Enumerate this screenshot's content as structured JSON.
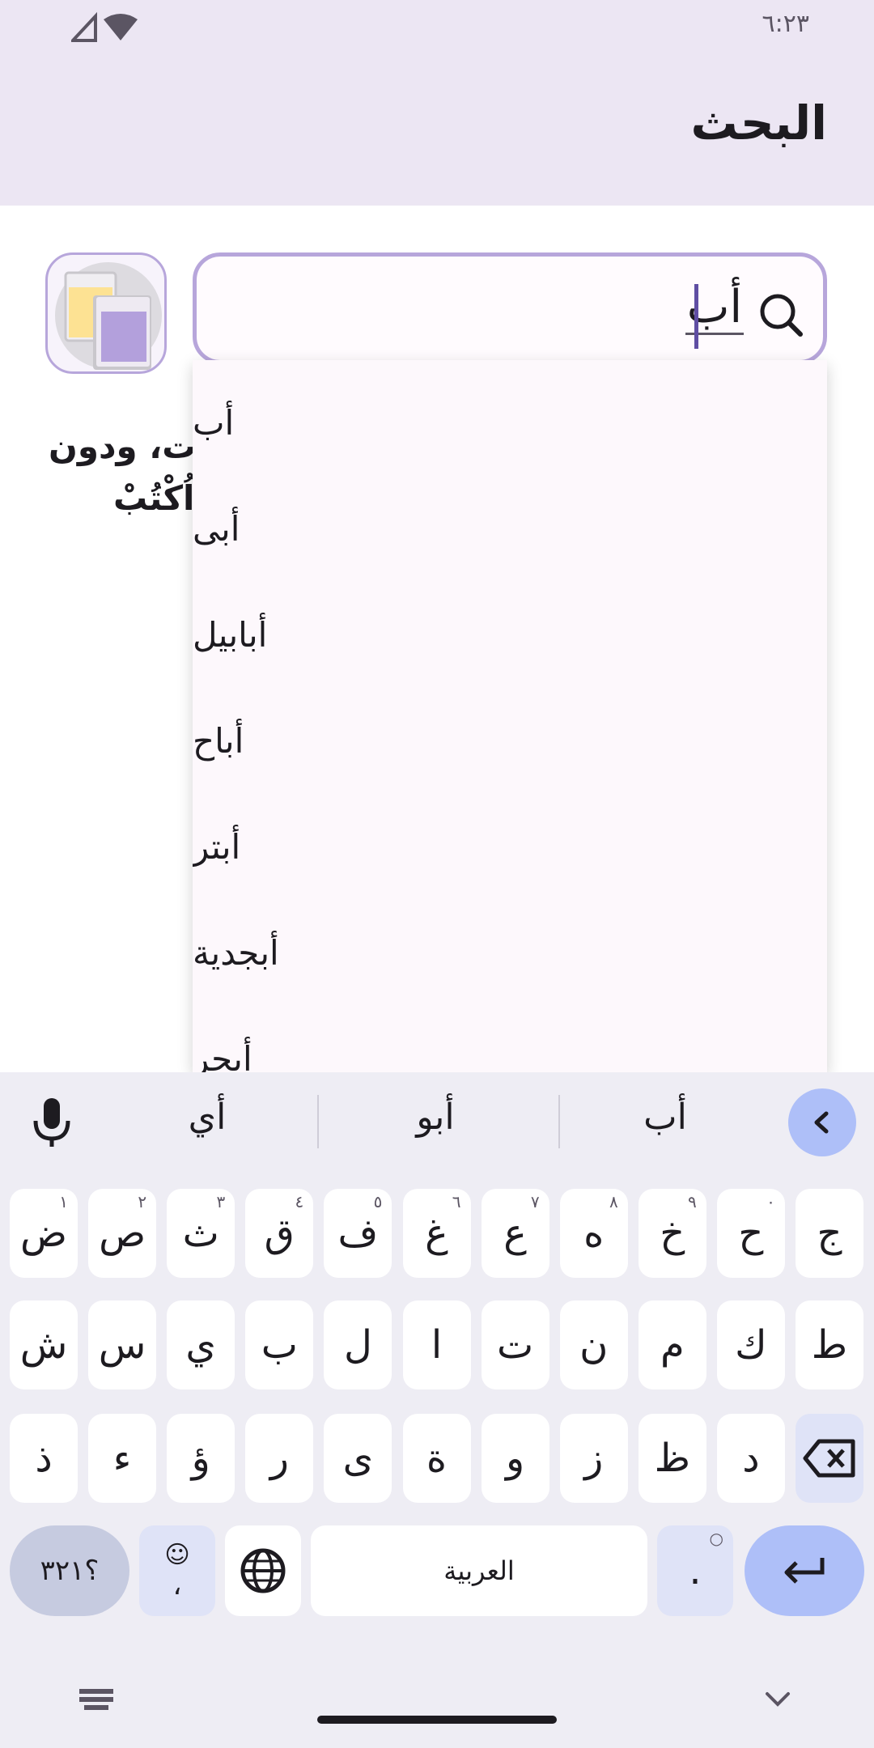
{
  "status": {
    "time": "٦:٢٣"
  },
  "header": {
    "title": "البحث"
  },
  "search": {
    "value": "أب"
  },
  "description": {
    "line1": "ت، ودون",
    "line2": "اُكْتُبْ"
  },
  "suggestions": [
    "أب",
    "أبى",
    "أبابيل",
    "أباح",
    "أبتر",
    "أبجدية",
    "أبحر"
  ],
  "keyboard": {
    "word_suggestions": [
      "أب",
      "أبو",
      "أي"
    ],
    "row1": [
      {
        "k": "ض",
        "n": "١"
      },
      {
        "k": "ص",
        "n": "٢"
      },
      {
        "k": "ث",
        "n": "٣"
      },
      {
        "k": "ق",
        "n": "٤"
      },
      {
        "k": "ف",
        "n": "٥"
      },
      {
        "k": "غ",
        "n": "٦"
      },
      {
        "k": "ع",
        "n": "٧"
      },
      {
        "k": "ه",
        "n": "٨"
      },
      {
        "k": "خ",
        "n": "٩"
      },
      {
        "k": "ح",
        "n": "٠"
      },
      {
        "k": "ج",
        "n": ""
      }
    ],
    "row2": [
      "ش",
      "س",
      "ي",
      "ب",
      "ل",
      "ا",
      "ت",
      "ن",
      "م",
      "ك",
      "ط"
    ],
    "row3": [
      "ذ",
      "ء",
      "ؤ",
      "ر",
      "ى",
      "ة",
      "و",
      "ز",
      "ظ",
      "د"
    ],
    "symbols_label": "؟٣٢١",
    "comma_label": "،",
    "period_label": ".",
    "space_label": "العربية"
  },
  "colors": {
    "accent": "#aebff8",
    "search_border": "#b7a6db",
    "app_bar": "#ece6f3"
  }
}
